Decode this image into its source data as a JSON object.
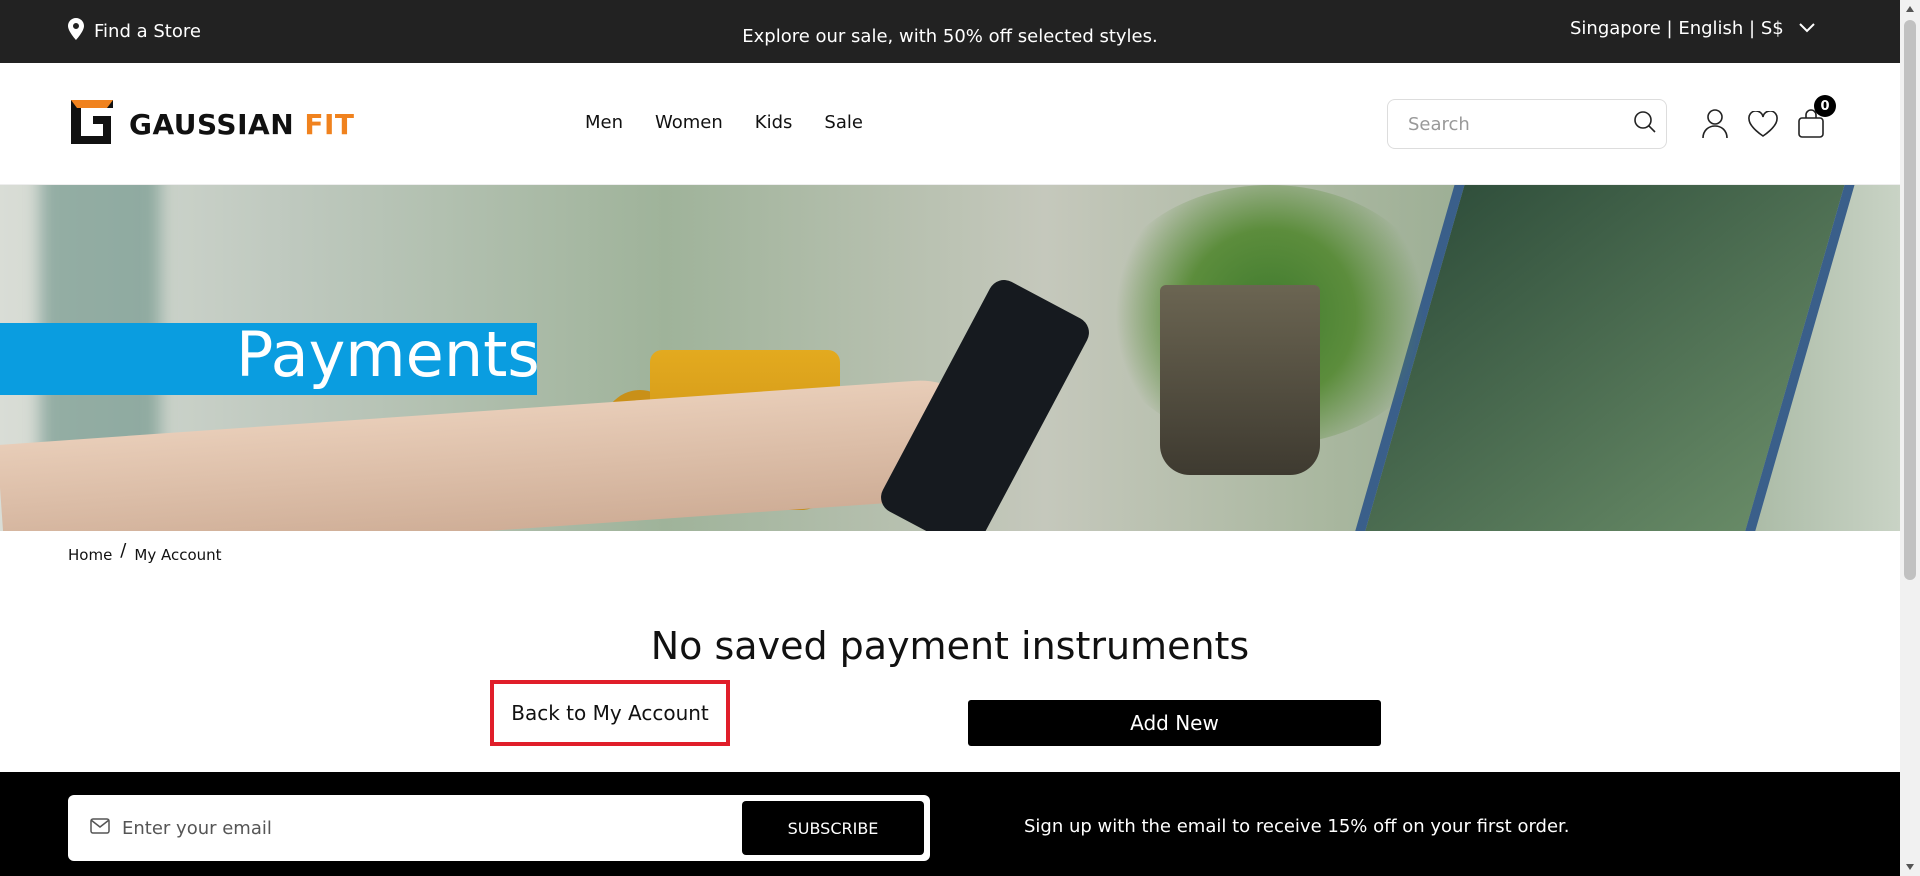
{
  "topbar": {
    "store_label": "Find a Store",
    "store_icon": "location-pin-icon",
    "promo": "Explore our sale, with 50% off selected styles.",
    "locale": "Singapore | English | S$"
  },
  "header": {
    "logo_main": "GAUSSIAN",
    "logo_accent": "FIT",
    "nav": [
      "Men",
      "Women",
      "Kids",
      "Sale"
    ],
    "search_placeholder": "Search",
    "cart_count": "0"
  },
  "hero": {
    "title": "Payments"
  },
  "breadcrumb": {
    "home": "Home",
    "separator": "/",
    "current": "My Account"
  },
  "main": {
    "title": "No saved payment instruments",
    "back_label": "Back to My Account",
    "add_label": "Add New"
  },
  "footer": {
    "email_placeholder": "Enter your email",
    "subscribe_label": "SUBSCRIBE",
    "signup_text": "Sign up with the email to receive 15% off on your first order."
  },
  "colors": {
    "accent": "#f0821e",
    "hero_title_bg": "#0a9de0",
    "highlight": "#e01e2a"
  }
}
